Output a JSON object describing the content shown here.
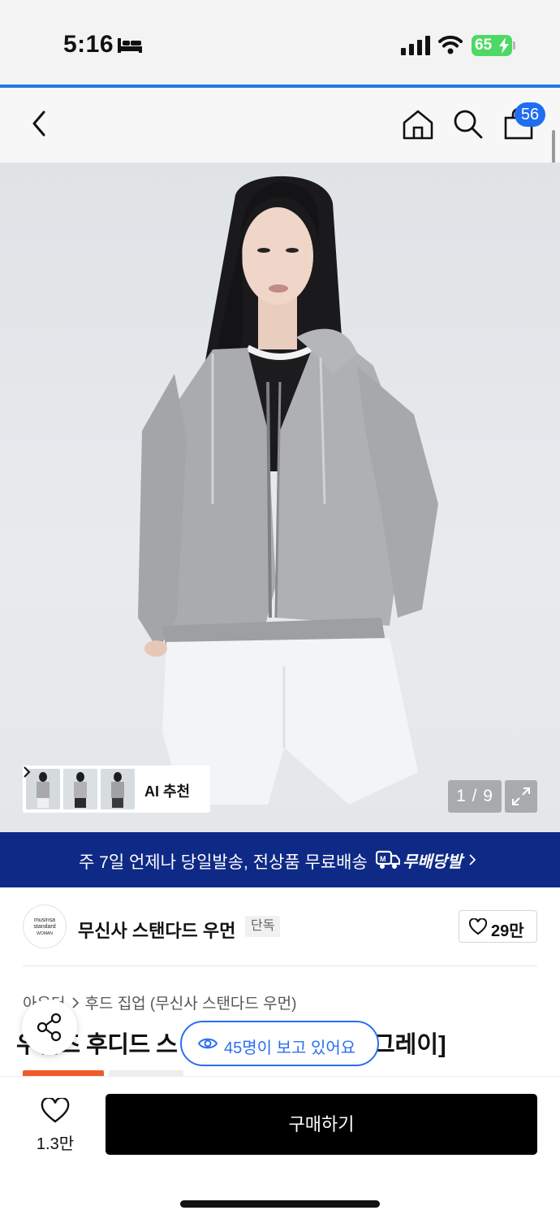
{
  "status_bar": {
    "time": "5:16",
    "battery": "65"
  },
  "header": {
    "cart_count": "56"
  },
  "gallery": {
    "ai_label": "AI 추천",
    "page_indicator": "1 / 9",
    "current_page": 1,
    "total_pages": 9
  },
  "banner": {
    "text": "주 7일 언제나 당일발송, 전상품 무료배송",
    "brand": "무배당발"
  },
  "brand": {
    "logo_line1": "musinsa",
    "logo_line2": "standard",
    "logo_line3": "WOMAN",
    "name": "무신사 스탠다드 우먼",
    "tag": "단독",
    "likes": "29만"
  },
  "product": {
    "category_1": "아우터",
    "category_2": "후드 집업 (무신사 스탠다드 우먼)",
    "title_left": "우먼즈 후디드 스",
    "title_right": "그레이]"
  },
  "viewers": {
    "text": "45명이 보고 있어요"
  },
  "bottom": {
    "wish_count": "1.3만",
    "buy_label": "구매하기"
  },
  "colors": {
    "accent": "#1f6df0",
    "banner_bg": "#0f2a86",
    "buy_bg": "#000000",
    "badge_red": "#f05a2a"
  }
}
